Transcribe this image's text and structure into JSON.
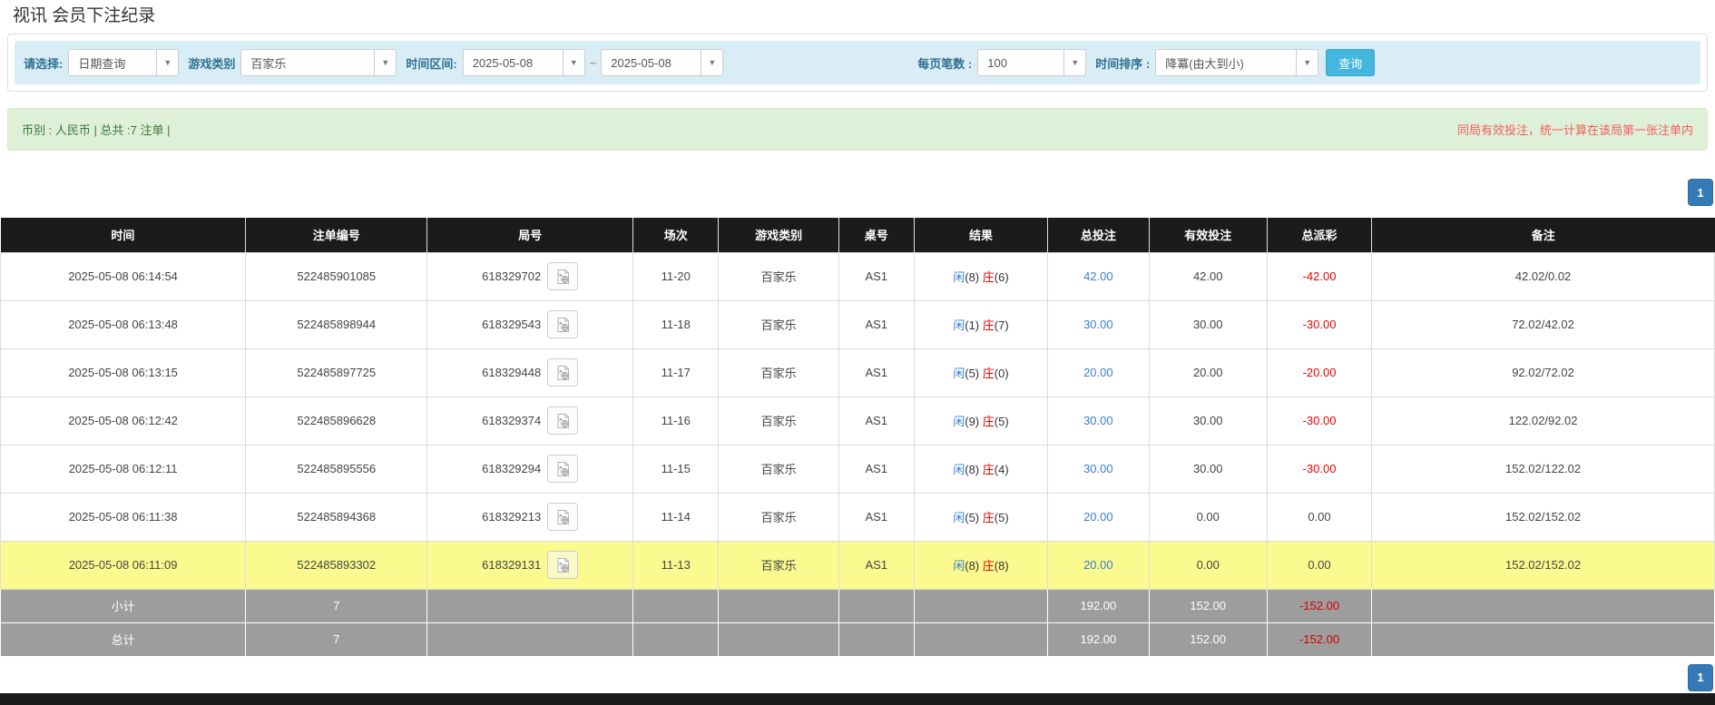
{
  "page": {
    "title": "视讯 会员下注纪录"
  },
  "filters": {
    "select_label": "请选择:",
    "select_value": "日期查询",
    "game_label": "游戏类别",
    "game_value": "百家乐",
    "range_label": "时间区间:",
    "date_from": "2025-05-08",
    "range_tilde": "~",
    "date_to": "2025-05-08",
    "per_page_label": "每页笔数 :",
    "per_page_value": "100",
    "sort_label": "时间排序 :",
    "sort_value": "降冪(由大到小)",
    "search_button": "查询"
  },
  "info_bar": {
    "left": "币别 : 人民币 | 总共 :7 注单 |",
    "right": "同局有效投注，统一计算在该局第一张注单内"
  },
  "pagination": {
    "page": "1"
  },
  "colors": {
    "accent_blue": "#337ab7",
    "link_blue": "#3a7bd5",
    "banker_red": "#e60000",
    "negative_red": "#ee0000",
    "filter_bar_bg": "#d9edf7",
    "info_bar_bg": "#dff0d8",
    "header_bg": "#1b1b1b",
    "highlight_yellow": "#fafa8e",
    "summary_gray": "#9d9d9d",
    "search_btn_bg": "#45b6dd"
  },
  "table": {
    "headers": [
      "时间",
      "注单编号",
      "局号",
      "场次",
      "游戏类别",
      "桌号",
      "结果",
      "总投注",
      "有效投注",
      "总派彩",
      "备注"
    ],
    "video_icon": "video-replay-icon",
    "rows": [
      {
        "time": "2025-05-08 06:14:54",
        "bet_id": "522485901085",
        "round_id": "618329702",
        "session": "11-20",
        "game": "百家乐",
        "table_no": "AS1",
        "result": {
          "player": "闲",
          "player_n": "(8)",
          "banker": "庄",
          "banker_n": "(6)"
        },
        "total_bet": "42.00",
        "valid_bet": "42.00",
        "payout": "-42.00",
        "remark": "42.02/0.02",
        "highlight": false
      },
      {
        "time": "2025-05-08 06:13:48",
        "bet_id": "522485898944",
        "round_id": "618329543",
        "session": "11-18",
        "game": "百家乐",
        "table_no": "AS1",
        "result": {
          "player": "闲",
          "player_n": "(1)",
          "banker": "庄",
          "banker_n": "(7)"
        },
        "total_bet": "30.00",
        "valid_bet": "30.00",
        "payout": "-30.00",
        "remark": "72.02/42.02",
        "highlight": false
      },
      {
        "time": "2025-05-08 06:13:15",
        "bet_id": "522485897725",
        "round_id": "618329448",
        "session": "11-17",
        "game": "百家乐",
        "table_no": "AS1",
        "result": {
          "player": "闲",
          "player_n": "(5)",
          "banker": "庄",
          "banker_n": "(0)"
        },
        "total_bet": "20.00",
        "valid_bet": "20.00",
        "payout": "-20.00",
        "remark": "92.02/72.02",
        "highlight": false
      },
      {
        "time": "2025-05-08 06:12:42",
        "bet_id": "522485896628",
        "round_id": "618329374",
        "session": "11-16",
        "game": "百家乐",
        "table_no": "AS1",
        "result": {
          "player": "闲",
          "player_n": "(9)",
          "banker": "庄",
          "banker_n": "(5)"
        },
        "total_bet": "30.00",
        "valid_bet": "30.00",
        "payout": "-30.00",
        "remark": "122.02/92.02",
        "highlight": false
      },
      {
        "time": "2025-05-08 06:12:11",
        "bet_id": "522485895556",
        "round_id": "618329294",
        "session": "11-15",
        "game": "百家乐",
        "table_no": "AS1",
        "result": {
          "player": "闲",
          "player_n": "(8)",
          "banker": "庄",
          "banker_n": "(4)"
        },
        "total_bet": "30.00",
        "valid_bet": "30.00",
        "payout": "-30.00",
        "remark": "152.02/122.02",
        "highlight": false
      },
      {
        "time": "2025-05-08 06:11:38",
        "bet_id": "522485894368",
        "round_id": "618329213",
        "session": "11-14",
        "game": "百家乐",
        "table_no": "AS1",
        "result": {
          "player": "闲",
          "player_n": "(5)",
          "banker": "庄",
          "banker_n": "(5)"
        },
        "total_bet": "20.00",
        "valid_bet": "0.00",
        "payout": "0.00",
        "remark": "152.02/152.02",
        "highlight": false
      },
      {
        "time": "2025-05-08 06:11:09",
        "bet_id": "522485893302",
        "round_id": "618329131",
        "session": "11-13",
        "game": "百家乐",
        "table_no": "AS1",
        "result": {
          "player": "闲",
          "player_n": "(8)",
          "banker": "庄",
          "banker_n": "(8)"
        },
        "total_bet": "20.00",
        "valid_bet": "0.00",
        "payout": "0.00",
        "remark": "152.02/152.02",
        "highlight": true
      }
    ],
    "summary": [
      {
        "label": "小计",
        "count": "7",
        "total_bet": "192.00",
        "valid_bet": "152.00",
        "payout": "-152.00"
      },
      {
        "label": "总计",
        "count": "7",
        "total_bet": "192.00",
        "valid_bet": "152.00",
        "payout": "-152.00"
      }
    ]
  }
}
